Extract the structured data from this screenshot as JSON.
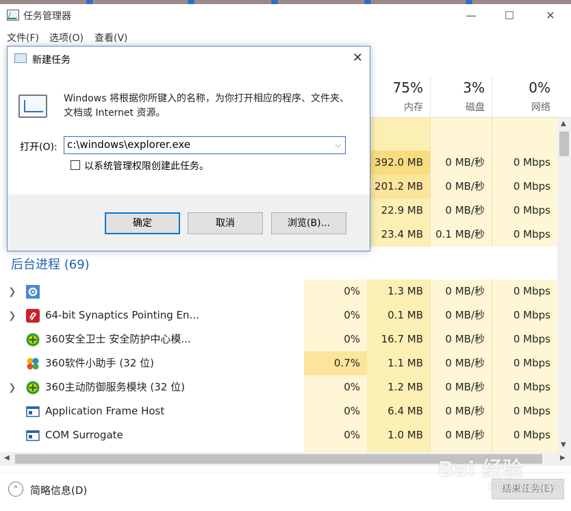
{
  "window": {
    "title": "任务管理器",
    "min_icon": "minimize-icon",
    "max_icon": "maximize-icon",
    "close_icon": "close-icon"
  },
  "menu": [
    "文件(F)",
    "选项(O)",
    "查看(V)"
  ],
  "columns": [
    {
      "pct": "75%",
      "label": "内存"
    },
    {
      "pct": "3%",
      "label": "磁盘"
    },
    {
      "pct": "0%",
      "label": "网络"
    }
  ],
  "top_rows": [
    {
      "cpu": "",
      "mem": "392.0 MB",
      "disk": "0 MB/秒",
      "net": "0 Mbps"
    },
    {
      "cpu": "",
      "mem": "201.2 MB",
      "disk": "0 MB/秒",
      "net": "0 Mbps"
    },
    {
      "cpu": "",
      "mem": "22.9 MB",
      "disk": "0 MB/秒",
      "net": "0 Mbps"
    },
    {
      "cpu": "",
      "mem": "23.4 MB",
      "disk": "0.1 MB/秒",
      "net": "0 Mbps"
    }
  ],
  "group_header": "后台进程 (69)",
  "processes": [
    {
      "name": "",
      "icon": "gear-icon",
      "expand": true,
      "cpu": "0%",
      "mem": "1.3 MB",
      "disk": "0 MB/秒",
      "net": "0 Mbps"
    },
    {
      "name": "64-bit Synaptics Pointing En...",
      "icon": "synaptics-icon",
      "expand": true,
      "cpu": "0%",
      "mem": "0.1 MB",
      "disk": "0 MB/秒",
      "net": "0 Mbps"
    },
    {
      "name": "360安全卫士 安全防护中心模...",
      "icon": "360-icon",
      "expand": false,
      "cpu": "0%",
      "mem": "16.7 MB",
      "disk": "0 MB/秒",
      "net": "0 Mbps"
    },
    {
      "name": "360软件小助手 (32 位)",
      "icon": "360-assistant-icon",
      "expand": false,
      "cpu": "0.7%",
      "mem": "1.1 MB",
      "disk": "0 MB/秒",
      "net": "0 Mbps"
    },
    {
      "name": "360主动防御服务模块 (32 位)",
      "icon": "360-icon",
      "expand": true,
      "cpu": "0%",
      "mem": "1.2 MB",
      "disk": "0 MB/秒",
      "net": "0 Mbps"
    },
    {
      "name": "Application Frame Host",
      "icon": "app-frame-icon",
      "expand": false,
      "cpu": "0%",
      "mem": "6.4 MB",
      "disk": "0 MB/秒",
      "net": "0 Mbps"
    },
    {
      "name": "COM Surrogate",
      "icon": "app-frame-icon",
      "expand": false,
      "cpu": "0%",
      "mem": "1.0 MB",
      "disk": "0 MB/秒",
      "net": "0 Mbps"
    }
  ],
  "footer": {
    "collapse": "简略信息(D)",
    "end_task": "结束任务(E)"
  },
  "watermark": {
    "main": "Bai 经验",
    "sub": "jingyan.baidu.com"
  },
  "dialog": {
    "title": "新建任务",
    "description": "Windows 将根据你所键入的名称，为你打开相应的程序、文件夹、文档或 Internet 资源。",
    "open_label": "打开(O):",
    "open_value": "c:\\windows\\explorer.exe",
    "admin_label": "以系统管理权限创建此任务。",
    "ok": "确定",
    "cancel": "取消",
    "browse": "浏览(B)..."
  },
  "colors": {
    "mem_col": "#fcefb4",
    "light_col": "#fff6d6",
    "hilite": "#f9dc7f",
    "accent": "#0078d7",
    "group": "#1c5fae"
  }
}
